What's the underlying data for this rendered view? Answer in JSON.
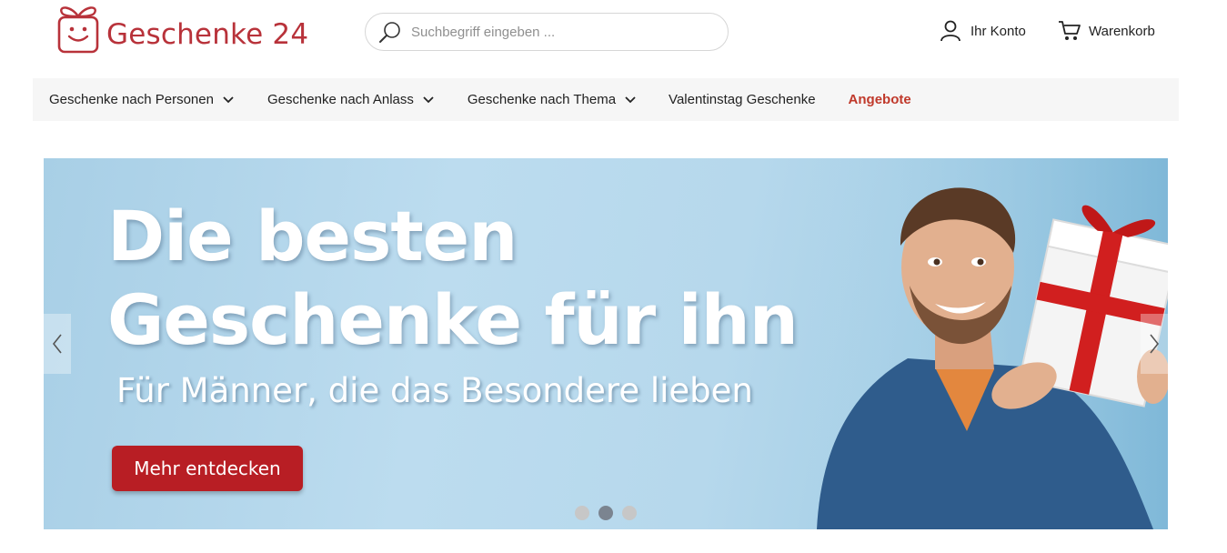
{
  "header": {
    "logo_text": "Geschenke 24",
    "search_placeholder": "Suchbegriff eingeben ...",
    "account_label": "Ihr Konto",
    "cart_label": "Warenkorb"
  },
  "nav": {
    "items": [
      {
        "label": "Geschenke nach Personen",
        "has_dropdown": true
      },
      {
        "label": "Geschenke nach Anlass",
        "has_dropdown": true
      },
      {
        "label": "Geschenke nach Thema",
        "has_dropdown": true
      },
      {
        "label": "Valentinstag Geschenke",
        "has_dropdown": false
      },
      {
        "label": "Angebote",
        "has_dropdown": false
      }
    ]
  },
  "hero": {
    "heading_line1": "Die besten",
    "heading_line2": "Geschenke für ihn",
    "subheading": "Für Männer, die das Besondere lieben",
    "cta_label": "Mehr entdecken",
    "active_slide": 2,
    "slide_count": 3
  },
  "colors": {
    "brand": "#b8323a",
    "cta": "#b81e24",
    "offers": "#c0392b",
    "nav_bg": "#f6f6f6",
    "hero_bg": "#b6d8ec"
  },
  "icons": [
    "gift-logo-icon",
    "search-icon",
    "user-icon",
    "cart-icon",
    "chevron-down-icon",
    "chevron-left-icon",
    "chevron-right-icon"
  ]
}
